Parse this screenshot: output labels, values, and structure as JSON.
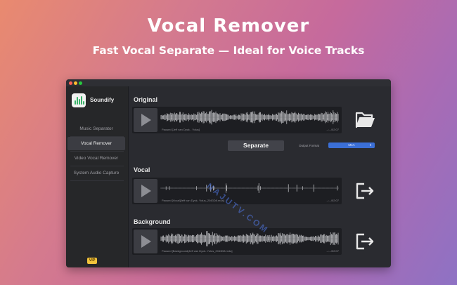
{
  "hero": {
    "title": "Vocal Remover",
    "subtitle": "Fast Vocal Separate — Ideal for Voice Tracks"
  },
  "app": {
    "name": "Soundify",
    "logo_icon": "waveform-logo-icon",
    "accent_color": "#3bb36a"
  },
  "sidebar": {
    "items": [
      {
        "label": "Music Separator",
        "active": false
      },
      {
        "label": "Vocal Remover",
        "active": true
      },
      {
        "label": "Video Vocal Remover",
        "active": false
      },
      {
        "label": "System Audio Capture",
        "active": false
      }
    ],
    "badge": "VIP"
  },
  "sections": {
    "original": {
      "title": "Original",
      "track_text": "Paused [Jeff van Dyck - Yolus]",
      "time": "--:--/02:07",
      "action_icon": "folder-open-icon"
    },
    "vocal": {
      "title": "Vocal",
      "track_text": "Paused [Vocal]Jeff van Dyck- Yolus_2043D8.m4a]",
      "time": "--:--/02:07",
      "action_icon": "export-icon"
    },
    "background": {
      "title": "Background",
      "track_text": "Paused [Background]Jeff van Dyck- Yolus_2043D8.m4a]",
      "time": "--:--/02:07",
      "action_icon": "export-icon"
    }
  },
  "controls": {
    "separate_label": "Separate",
    "output_format_label": "Output Format",
    "output_format_value": "M4A",
    "select_color": "#3b6fd6"
  },
  "watermark": "NAJUTV.COM"
}
